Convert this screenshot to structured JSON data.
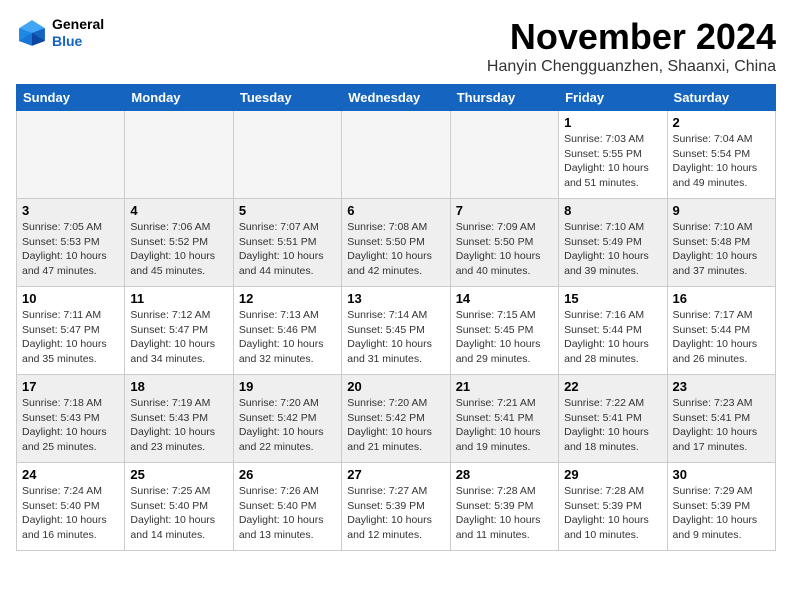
{
  "header": {
    "logo_line1": "General",
    "logo_line2": "Blue",
    "month_title": "November 2024",
    "location": "Hanyin Chengguanzhen, Shaanxi, China"
  },
  "weekdays": [
    "Sunday",
    "Monday",
    "Tuesday",
    "Wednesday",
    "Thursday",
    "Friday",
    "Saturday"
  ],
  "weeks": [
    [
      {
        "day": "",
        "info": ""
      },
      {
        "day": "",
        "info": ""
      },
      {
        "day": "",
        "info": ""
      },
      {
        "day": "",
        "info": ""
      },
      {
        "day": "",
        "info": ""
      },
      {
        "day": "1",
        "info": "Sunrise: 7:03 AM\nSunset: 5:55 PM\nDaylight: 10 hours\nand 51 minutes."
      },
      {
        "day": "2",
        "info": "Sunrise: 7:04 AM\nSunset: 5:54 PM\nDaylight: 10 hours\nand 49 minutes."
      }
    ],
    [
      {
        "day": "3",
        "info": "Sunrise: 7:05 AM\nSunset: 5:53 PM\nDaylight: 10 hours\nand 47 minutes."
      },
      {
        "day": "4",
        "info": "Sunrise: 7:06 AM\nSunset: 5:52 PM\nDaylight: 10 hours\nand 45 minutes."
      },
      {
        "day": "5",
        "info": "Sunrise: 7:07 AM\nSunset: 5:51 PM\nDaylight: 10 hours\nand 44 minutes."
      },
      {
        "day": "6",
        "info": "Sunrise: 7:08 AM\nSunset: 5:50 PM\nDaylight: 10 hours\nand 42 minutes."
      },
      {
        "day": "7",
        "info": "Sunrise: 7:09 AM\nSunset: 5:50 PM\nDaylight: 10 hours\nand 40 minutes."
      },
      {
        "day": "8",
        "info": "Sunrise: 7:10 AM\nSunset: 5:49 PM\nDaylight: 10 hours\nand 39 minutes."
      },
      {
        "day": "9",
        "info": "Sunrise: 7:10 AM\nSunset: 5:48 PM\nDaylight: 10 hours\nand 37 minutes."
      }
    ],
    [
      {
        "day": "10",
        "info": "Sunrise: 7:11 AM\nSunset: 5:47 PM\nDaylight: 10 hours\nand 35 minutes."
      },
      {
        "day": "11",
        "info": "Sunrise: 7:12 AM\nSunset: 5:47 PM\nDaylight: 10 hours\nand 34 minutes."
      },
      {
        "day": "12",
        "info": "Sunrise: 7:13 AM\nSunset: 5:46 PM\nDaylight: 10 hours\nand 32 minutes."
      },
      {
        "day": "13",
        "info": "Sunrise: 7:14 AM\nSunset: 5:45 PM\nDaylight: 10 hours\nand 31 minutes."
      },
      {
        "day": "14",
        "info": "Sunrise: 7:15 AM\nSunset: 5:45 PM\nDaylight: 10 hours\nand 29 minutes."
      },
      {
        "day": "15",
        "info": "Sunrise: 7:16 AM\nSunset: 5:44 PM\nDaylight: 10 hours\nand 28 minutes."
      },
      {
        "day": "16",
        "info": "Sunrise: 7:17 AM\nSunset: 5:44 PM\nDaylight: 10 hours\nand 26 minutes."
      }
    ],
    [
      {
        "day": "17",
        "info": "Sunrise: 7:18 AM\nSunset: 5:43 PM\nDaylight: 10 hours\nand 25 minutes."
      },
      {
        "day": "18",
        "info": "Sunrise: 7:19 AM\nSunset: 5:43 PM\nDaylight: 10 hours\nand 23 minutes."
      },
      {
        "day": "19",
        "info": "Sunrise: 7:20 AM\nSunset: 5:42 PM\nDaylight: 10 hours\nand 22 minutes."
      },
      {
        "day": "20",
        "info": "Sunrise: 7:20 AM\nSunset: 5:42 PM\nDaylight: 10 hours\nand 21 minutes."
      },
      {
        "day": "21",
        "info": "Sunrise: 7:21 AM\nSunset: 5:41 PM\nDaylight: 10 hours\nand 19 minutes."
      },
      {
        "day": "22",
        "info": "Sunrise: 7:22 AM\nSunset: 5:41 PM\nDaylight: 10 hours\nand 18 minutes."
      },
      {
        "day": "23",
        "info": "Sunrise: 7:23 AM\nSunset: 5:41 PM\nDaylight: 10 hours\nand 17 minutes."
      }
    ],
    [
      {
        "day": "24",
        "info": "Sunrise: 7:24 AM\nSunset: 5:40 PM\nDaylight: 10 hours\nand 16 minutes."
      },
      {
        "day": "25",
        "info": "Sunrise: 7:25 AM\nSunset: 5:40 PM\nDaylight: 10 hours\nand 14 minutes."
      },
      {
        "day": "26",
        "info": "Sunrise: 7:26 AM\nSunset: 5:40 PM\nDaylight: 10 hours\nand 13 minutes."
      },
      {
        "day": "27",
        "info": "Sunrise: 7:27 AM\nSunset: 5:39 PM\nDaylight: 10 hours\nand 12 minutes."
      },
      {
        "day": "28",
        "info": "Sunrise: 7:28 AM\nSunset: 5:39 PM\nDaylight: 10 hours\nand 11 minutes."
      },
      {
        "day": "29",
        "info": "Sunrise: 7:28 AM\nSunset: 5:39 PM\nDaylight: 10 hours\nand 10 minutes."
      },
      {
        "day": "30",
        "info": "Sunrise: 7:29 AM\nSunset: 5:39 PM\nDaylight: 10 hours\nand 9 minutes."
      }
    ]
  ]
}
